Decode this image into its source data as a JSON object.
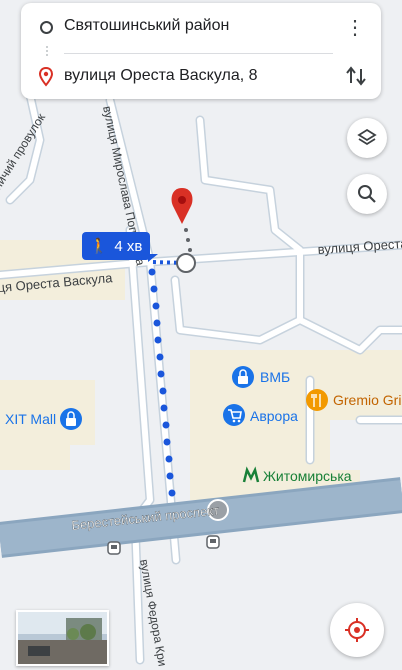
{
  "route": {
    "origin": "Святошинський район",
    "destination": "вулиця Ореста Васкула, 8"
  },
  "walk_badge": {
    "duration": "4 хв"
  },
  "map_labels": {
    "street_orest_top": "вулиця Ореста",
    "street_orest_left": "ця Ореста Васкула",
    "street_popovych": "вулиця Мирослава Поповича",
    "street_provulok": "вничий провулок",
    "street_berest": "Берестейський проспект",
    "street_fedora": "вулиця Федора Кри",
    "poi_vmb": "ВМБ",
    "poi_avrora": "Аврора",
    "poi_gremio": "Gremio Gril",
    "poi_xit": "XIT Mall",
    "poi_metro": "Житомирська"
  },
  "colors": {
    "route": "#1a56db",
    "pin": "#d93025",
    "poi_blue": "#1a73e8",
    "poi_orange": "#f29900",
    "metro": "#188038",
    "avenue": "#8ba6bf"
  },
  "icons": [
    "origin-circle-icon",
    "pin-icon",
    "more-vert-icon",
    "swap-icon",
    "layers-icon",
    "search-icon",
    "locate-icon",
    "walk-icon",
    "shopping-bag-icon",
    "cart-icon",
    "fork-knife-icon",
    "metro-icon",
    "bus-stop-icon"
  ]
}
